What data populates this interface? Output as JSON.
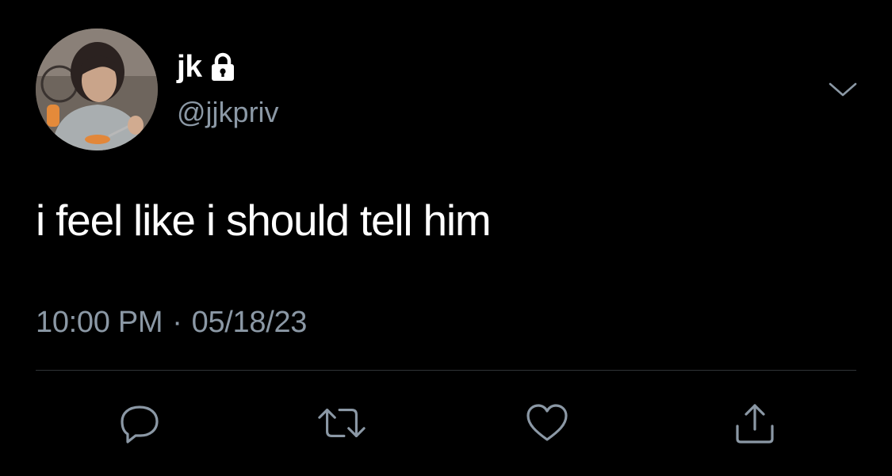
{
  "author": {
    "display_name": "jk",
    "handle": "@jjkpriv",
    "protected": true,
    "avatar": "profile-photo"
  },
  "tweet": {
    "text": "i feel like i should tell him",
    "time": "10:00 PM",
    "separator": "·",
    "date": "05/18/23"
  },
  "actions": [
    {
      "icon": "reply-icon"
    },
    {
      "icon": "retweet-icon"
    },
    {
      "icon": "like-icon"
    },
    {
      "icon": "share-icon"
    }
  ],
  "colors": {
    "background": "#000000",
    "primary_text": "#ffffff",
    "secondary_text": "#8b98a5",
    "divider": "#2f3336"
  }
}
